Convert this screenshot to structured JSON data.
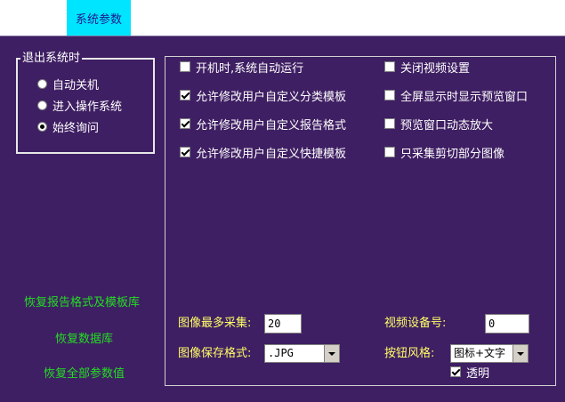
{
  "tab": {
    "label": "系统参数"
  },
  "exit_group": {
    "title": "退出系统时",
    "options": [
      {
        "label": "自动关机",
        "checked": false
      },
      {
        "label": "进入操作系统",
        "checked": false
      },
      {
        "label": "始终询问",
        "checked": true
      }
    ]
  },
  "actions": {
    "restore_report": "恢复报告格式及模板库",
    "restore_db": "恢复数据库",
    "restore_all": "恢复全部参数值"
  },
  "options_left": [
    {
      "label": "开机时,系统自动运行",
      "checked": false
    },
    {
      "label": "允许修改用户自定义分类模板",
      "checked": true
    },
    {
      "label": "允许修改用户自定义报告格式",
      "checked": true
    },
    {
      "label": "允许修改用户自定义快捷模板",
      "checked": true
    }
  ],
  "options_right": [
    {
      "label": "关闭视频设置",
      "checked": false
    },
    {
      "label": "全屏显示时显示预览窗口",
      "checked": false
    },
    {
      "label": "预览窗口动态放大",
      "checked": false
    },
    {
      "label": "只采集剪切部分图像",
      "checked": false
    }
  ],
  "capture": {
    "max_label": "图像最多采集:",
    "max_value": "20",
    "format_label": "图像保存格式:",
    "format_value": ".JPG"
  },
  "video": {
    "device_label": "视频设备号:",
    "device_value": "0",
    "style_label": "按钮风格:",
    "style_value": "图标+文字",
    "transparent_label": "透明",
    "transparent_checked": true
  },
  "colors": {
    "panel_bg": "#3f1f63",
    "tab_bg": "#00e5ff",
    "link": "#22dd22",
    "field_label": "#ffff66"
  }
}
